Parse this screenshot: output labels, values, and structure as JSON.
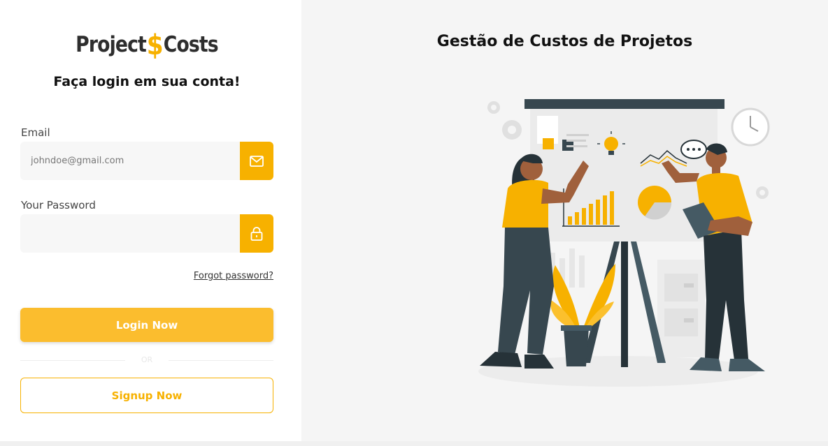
{
  "brand": {
    "logo_left": "Project",
    "logo_symbol": "$",
    "logo_right": "Costs",
    "accent_color": "#f7b100"
  },
  "login": {
    "subtitle": "Faça login em sua conta!",
    "email_label": "Email",
    "email_placeholder": "johndoe@gmail.com",
    "email_icon": "envelope-icon",
    "password_label": "Your Password",
    "password_placeholder": "",
    "password_icon": "lock-icon",
    "forgot_link": "Forgot password?",
    "login_button": "Login Now",
    "divider_text": "OR",
    "signup_button": "Signup Now"
  },
  "hero": {
    "title": "Gestão de Custos de Projetos",
    "illustration": "presentation-illustration"
  }
}
